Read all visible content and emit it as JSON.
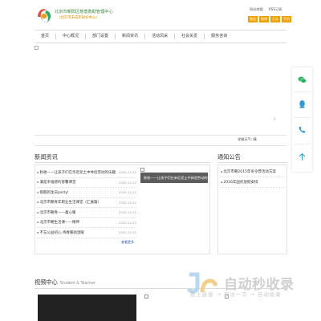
{
  "header": {
    "org_name": "北京市朝阳区慈善救助管理中心",
    "org_sub": "（北京市未成年保护中心）",
    "top_links": [
      "网站地图",
      "RSS订阅"
    ],
    "top_tags": [
      "微信",
      "微博",
      "互动",
      "手机"
    ]
  },
  "nav": {
    "items": [
      "首页",
      "中心概况",
      "部门设置",
      "新闻资讯",
      "活动风采",
      "社会关爱",
      "服务咨询"
    ]
  },
  "side": {
    "icons": [
      "wechat-icon",
      "qq-icon",
      "phone-icon",
      "back-to-top-icon"
    ],
    "colors": {
      "icon": "#2e9bd8",
      "wechat": "#26b05d"
    }
  },
  "misc": {
    "small_mark": "r",
    "weather": "学校天气: 晴"
  },
  "news": {
    "title": "新闻资讯",
    "items": [
      {
        "text": "秋收——让孩子们在亲近泥土中体验劳动的乐趣",
        "date": "2020-12-22"
      },
      {
        "text": "满是幸福感的冒馨课堂",
        "date": "2020-12-22"
      },
      {
        "text": "假期的生日party!",
        "date": "2020-12-22"
      },
      {
        "text": "北京市朝青年职业生活课堂（汇展篇）",
        "date": "2020-12-22"
      },
      {
        "text": "北京市朝青——童心暖",
        "date": "2020-12-22"
      },
      {
        "text": "北京市朝生活课——精神",
        "date": "2020-12-22"
      },
      {
        "text": "不忘公益初心 待春暖助温暖",
        "date": "2020-12-22"
      }
    ],
    "more": "查看更多",
    "photo_caption": "秋收——让孩子们在亲近泥土中体验劳动的"
  },
  "notice": {
    "title": "通知公告",
    "items": [
      "北京市朝2015年冬令营活动方案",
      "2016年国庆放假安排"
    ]
  },
  "video": {
    "title": "视频中心",
    "subtitle": "Student & Teacher"
  },
  "watermark": {
    "title": "自动秒收录",
    "slogan": "数上链接 → 来访一次 → 自动收录"
  }
}
